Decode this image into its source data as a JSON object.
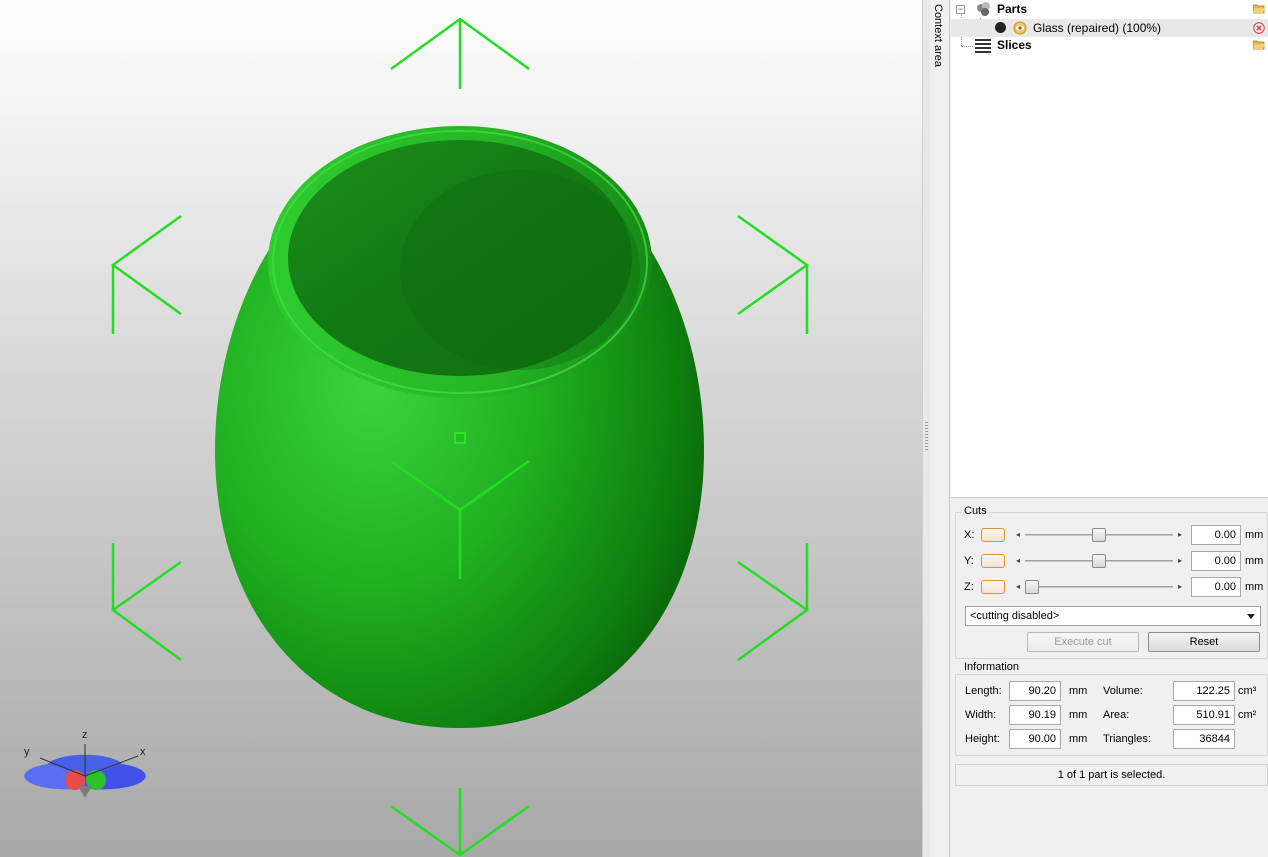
{
  "window": {
    "context_tab_label": "Context area"
  },
  "tree": {
    "parts_label": "Parts",
    "part_item_label": "Glass (repaired) (100%)",
    "slices_label": "Slices"
  },
  "cuts": {
    "title": "Cuts",
    "x": {
      "label": "X:",
      "value": "0.00",
      "unit": "mm",
      "slider_fraction": 0.5
    },
    "y": {
      "label": "Y:",
      "value": "0.00",
      "unit": "mm",
      "slider_fraction": 0.5
    },
    "z": {
      "label": "Z:",
      "value": "0.00",
      "unit": "mm",
      "slider_fraction": 0.0
    },
    "mode_selected": "<cutting disabled>",
    "execute_label": "Execute cut",
    "reset_label": "Reset"
  },
  "information": {
    "title": "Information",
    "length": {
      "label": "Length:",
      "value": "90.20",
      "unit": "mm"
    },
    "width": {
      "label": "Width:",
      "value": "90.19",
      "unit": "mm"
    },
    "height": {
      "label": "Height:",
      "value": "90.00",
      "unit": "mm"
    },
    "volume": {
      "label": "Volume:",
      "value": "122.25",
      "unit": "cm³"
    },
    "area": {
      "label": "Area:",
      "value": "510.91",
      "unit": "cm²"
    },
    "triangles": {
      "label": "Triangles:",
      "value": "36844"
    }
  },
  "status": "1 of 1 part is selected.",
  "axis": {
    "x": "x",
    "y": "y",
    "z": "z"
  },
  "colors": {
    "model": "#22b822",
    "selection": "#22dd22",
    "toggle_border": "#e0903a"
  }
}
